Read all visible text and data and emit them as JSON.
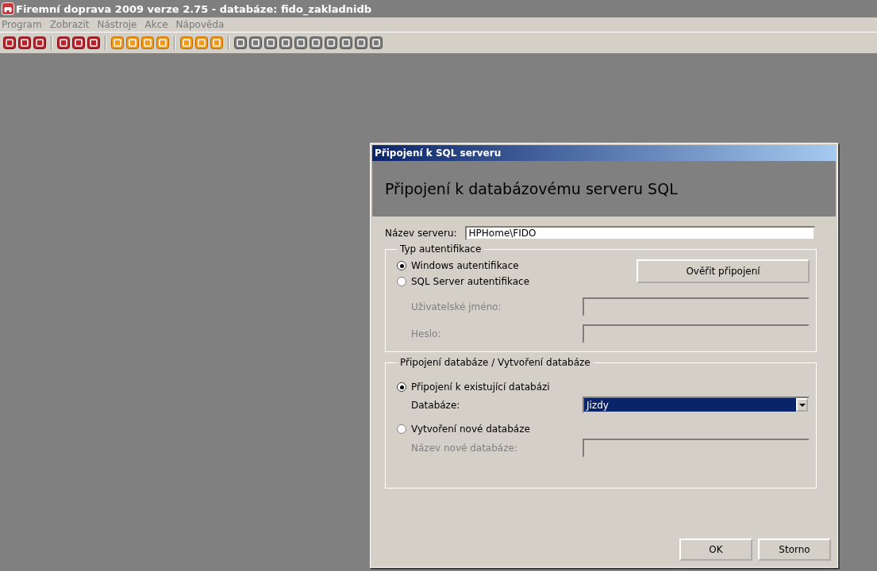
{
  "window": {
    "title": "Firemní doprava 2009 verze 2.75 - databáze: fido_zakladnidb"
  },
  "menu": [
    "Program",
    "Zobrazit",
    "Nástroje",
    "Akce",
    "Nápověda"
  ],
  "dialog": {
    "title": "Připojení k SQL serveru",
    "heading": "Připojení k databázovému serveru SQL",
    "server": {
      "label": "Název serveru:",
      "value": "HPHome\\FIDO"
    },
    "auth": {
      "legend": "Typ autentifikace",
      "options": [
        {
          "label": "Windows autentifikace",
          "selected": true
        },
        {
          "label": "SQL Server autentifikace",
          "selected": false
        }
      ],
      "verify_button": "Ověřit připojení",
      "fields": [
        {
          "label": "Uživatelské jméno:",
          "disabled": true
        },
        {
          "label": "Heslo:",
          "disabled": true
        }
      ]
    },
    "database": {
      "legend": "Připojení databáze / Vytvoření databáze",
      "options": [
        {
          "label": "Připojení k existující databázi",
          "selected": true
        },
        {
          "label": "Vytvoření nové databáze",
          "selected": false
        }
      ],
      "select": {
        "label": "Databáze:",
        "value": "Jizdy"
      },
      "new_name": {
        "label": "Název nové databáze:",
        "disabled": true
      }
    },
    "buttons": [
      "OK",
      "Storno"
    ]
  }
}
